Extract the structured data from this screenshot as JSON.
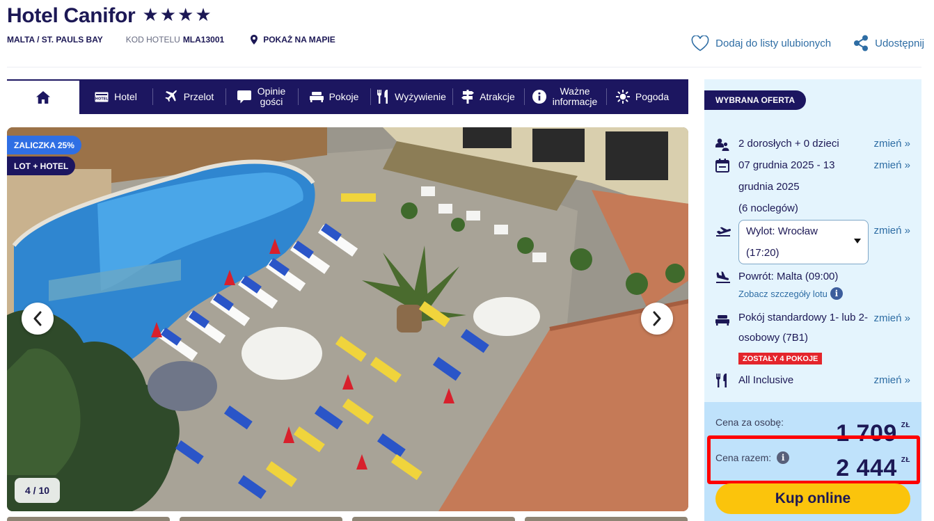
{
  "hotel": {
    "name": "Hotel Canifor",
    "stars": "★★★★",
    "location": "MALTA / ST. PAULS BAY",
    "code_label": "KOD HOTELU",
    "code": "MLA13001",
    "map_link": "POKAŻ NA MAPIE"
  },
  "header_actions": {
    "favorite": "Dodaj do listy ulubionych",
    "share": "Udostępnij"
  },
  "nav": {
    "items": [
      {
        "label": "Hotel",
        "icon": "hotel-icon"
      },
      {
        "label": "Przelot",
        "icon": "plane-icon"
      },
      {
        "label": "Opinie gości",
        "icon": "speech-bubble-icon"
      },
      {
        "label": "Pokoje",
        "icon": "bed-icon"
      },
      {
        "label": "Wyżywienie",
        "icon": "cutlery-icon"
      },
      {
        "label": "Atrakcje",
        "icon": "signpost-icon"
      },
      {
        "label": "Ważne informacje",
        "icon": "info-icon"
      },
      {
        "label": "Pogoda",
        "icon": "sun-icon"
      }
    ]
  },
  "gallery": {
    "badge_deposit": "ZALICZKA 25%",
    "badge_type": "LOT + HOTEL",
    "counter": "4 / 10"
  },
  "offer": {
    "tag": "WYBRANA OFERTA",
    "change_label": "zmień »",
    "guests": "2 dorosłych + 0 dzieci",
    "dates": "07 grudnia 2025 - 13 grudnia 2025",
    "nights": "(6 noclegów)",
    "departure": "Wylot: Wrocław (17:20)",
    "return": "Powrót: Malta (09:00)",
    "flight_details": "Zobacz szczegóły lotu",
    "room": "Pokój standardowy 1- lub 2-osobowy (7B1)",
    "rooms_left": "ZOSTAŁY 4 POKOJE",
    "board": "All Inclusive"
  },
  "price": {
    "per_person_label": "Cena za osobę:",
    "per_person_value": "1 709",
    "total_label": "Cena razem:",
    "total_value": "2 444",
    "currency": "ZŁ"
  },
  "cta": {
    "buy": "Kup online"
  },
  "colors": {
    "navy": "#1c1660",
    "link_blue": "#2e6da4",
    "offer_bg": "#e4f4fd",
    "price_bg": "#bfe2fb",
    "cta_yellow": "#fbc40c",
    "alert_red": "#e4252b",
    "highlight_red": "#ff0000"
  }
}
